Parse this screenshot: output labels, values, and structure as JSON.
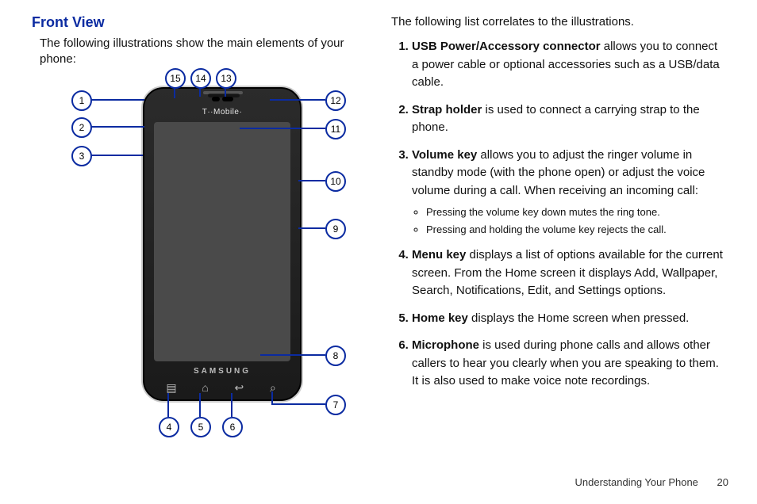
{
  "section": {
    "title": "Front View",
    "intro": "The following illustrations show the main elements of your phone:"
  },
  "correlate_intro": "The following list correlates to the illustrations.",
  "callouts": [
    "1",
    "2",
    "3",
    "4",
    "5",
    "6",
    "7",
    "8",
    "9",
    "10",
    "11",
    "12",
    "13",
    "14",
    "15"
  ],
  "phone": {
    "carrier": "T··Mobile·",
    "brand": "SAMSUNG",
    "softkeys": {
      "menu": "▤",
      "home": "⌂",
      "back": "↩",
      "search": "⌕"
    }
  },
  "features": [
    {
      "n": "1.",
      "term": "USB Power/Accessory connector",
      "rest": " allows you to connect a power cable or optional accessories such as a USB/data cable."
    },
    {
      "n": "2.",
      "term": "Strap holder",
      "rest": " is used to connect a carrying strap to the phone."
    },
    {
      "n": "3.",
      "term": "Volume key",
      "rest": " allows you to adjust the ringer volume in standby mode (with the phone open) or adjust the voice volume during a call. When receiving an incoming call:",
      "sub": [
        "Pressing the volume key down mutes the ring tone.",
        "Pressing and holding the volume key rejects the call."
      ]
    },
    {
      "n": "4.",
      "term": "Menu key",
      "rest": " displays a list of options available for the current screen. From the Home screen it displays Add, Wallpaper, Search, Notifications, Edit, and Settings options."
    },
    {
      "n": "5.",
      "term": "Home key",
      "rest": " displays the Home screen when pressed."
    },
    {
      "n": "6.",
      "term": "Microphone",
      "rest": " is used during phone calls and allows other callers to hear you clearly when you are speaking to them. It is also used to make voice note recordings."
    }
  ],
  "footer": {
    "section": "Understanding Your Phone",
    "page": "20"
  }
}
